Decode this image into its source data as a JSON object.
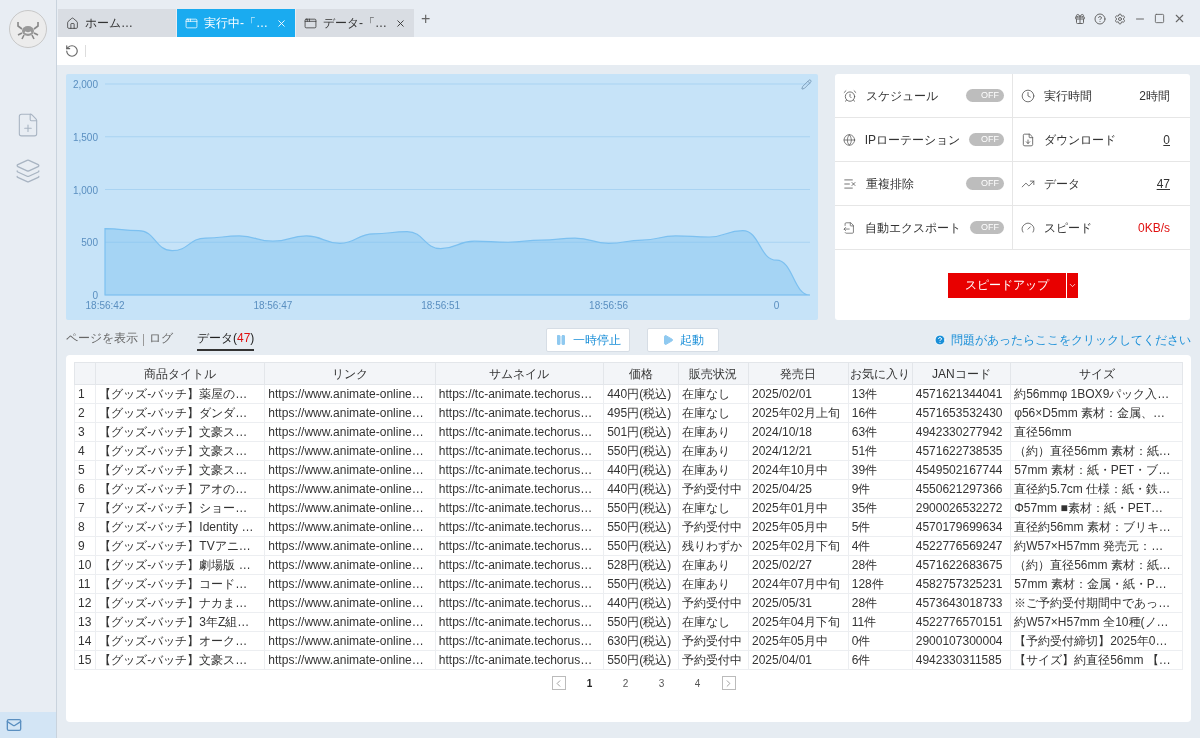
{
  "tabs": [
    {
      "kind": "home",
      "label": "ホーム…",
      "closable": false,
      "selected": false
    },
    {
      "kind": "page",
      "label": "実行中-「…",
      "closable": true,
      "selected": true
    },
    {
      "kind": "page",
      "label": "データ-「…",
      "closable": true,
      "selected": false
    }
  ],
  "new_tab": "+",
  "chart": {
    "chart_data": {
      "type": "area",
      "categories": [
        "18:56:42",
        null,
        null,
        null,
        null,
        "18:56:47",
        null,
        null,
        null,
        null,
        "18:56:51",
        null,
        null,
        null,
        null,
        "18:56:56",
        null,
        null,
        null,
        null,
        "0",
        null
      ],
      "series": [
        {
          "color": "#7cc0f0",
          "values": [
            630,
            610,
            420,
            540,
            560,
            510,
            560,
            490,
            580,
            600,
            440,
            510,
            500,
            520,
            540,
            490,
            520,
            560,
            550,
            610,
            330,
            0
          ]
        }
      ],
      "grid": true,
      "ylim": [
        0,
        2000
      ],
      "yticks": [
        {
          "value": 0,
          "label": "0"
        },
        {
          "value": 500,
          "label": "500"
        },
        {
          "value": 1000,
          "label": "1,000"
        },
        {
          "value": 1500,
          "label": "1,500"
        },
        {
          "value": 2000,
          "label": "2,000"
        }
      ]
    }
  },
  "settings": [
    {
      "kind": "schedule",
      "label": "スケジュール",
      "toggle_label": "OFF",
      "on": false
    },
    {
      "kind": "ip",
      "label": "IPローテーション",
      "toggle_label": "OFF",
      "on": false
    },
    {
      "kind": "dedupe",
      "label": "重複排除",
      "toggle_label": "OFF",
      "on": false
    },
    {
      "kind": "export",
      "label": "自動エクスポート",
      "toggle_label": "OFF",
      "on": false
    }
  ],
  "stats": [
    {
      "kind": "time",
      "label": "実行時間",
      "value": "2時間"
    },
    {
      "kind": "download",
      "label": "ダウンロード",
      "value": "0"
    },
    {
      "kind": "data",
      "label": "データ",
      "value": "47"
    },
    {
      "kind": "speed",
      "label": "スピード",
      "value": "0KB/s"
    }
  ],
  "speed_up_button": "スピードアップ",
  "view_tabs": [
    {
      "label": "ページを表示",
      "selected": false
    },
    {
      "label": "ログ",
      "selected": false
    },
    {
      "label": "データ",
      "count": "47",
      "brackets": [
        "(",
        ")"
      ],
      "selected": true
    }
  ],
  "controls": [
    {
      "kind": "pause",
      "label": "一時停止"
    },
    {
      "kind": "play",
      "label": "起動"
    }
  ],
  "help_link": "問題があったらここをクリックしてください",
  "table": {
    "columns": [
      "",
      "商品タイトル",
      "リンク",
      "サムネイル",
      "価格",
      "販売状況",
      "発売日",
      "お気に入り",
      "JANコード",
      "サイズ"
    ],
    "rows": [
      [
        "1",
        "【グッズ-バッチ】薬屋の…",
        "https://www.animate-online…",
        "https://tc-animate.techorus…",
        "440円(税込)",
        "在庫なし",
        "2025/02/01",
        "13件",
        "4571621344041",
        "約56mmφ 1BOX9パック入…"
      ],
      [
        "2",
        "【グッズ-バッチ】ダンダ…",
        "https://www.animate-online…",
        "https://tc-animate.techorus…",
        "495円(税込)",
        "在庫なし",
        "2025年02月上旬",
        "16件",
        "4571653532430",
        "φ56×D5mm 素材：金属、…"
      ],
      [
        "3",
        "【グッズ-バッチ】文豪ス…",
        "https://www.animate-online…",
        "https://tc-animate.techorus…",
        "501円(税込)",
        "在庫あり",
        "2024/10/18",
        "63件",
        "4942330277942",
        "直径56mm"
      ],
      [
        "4",
        "【グッズ-バッチ】文豪ス…",
        "https://www.animate-online…",
        "https://tc-animate.techorus…",
        "550円(税込)",
        "在庫あり",
        "2024/12/21",
        "51件",
        "4571622738535",
        "（約）直径56mm 素材：紙…"
      ],
      [
        "5",
        "【グッズ-バッチ】文豪ス…",
        "https://www.animate-online…",
        "https://tc-animate.techorus…",
        "440円(税込)",
        "在庫あり",
        "2024年10月中",
        "39件",
        "4549502167744",
        "57mm 素材：紙・PET・ブ…"
      ],
      [
        "6",
        "【グッズ-バッチ】アオの…",
        "https://www.animate-online…",
        "https://tc-animate.techorus…",
        "440円(税込)",
        "予約受付中",
        "2025/04/25",
        "9件",
        "4550621297366",
        "直径約5.7cm 仕様：紙・鉄…"
      ],
      [
        "7",
        "【グッズ-バッチ】ショー…",
        "https://www.animate-online…",
        "https://tc-animate.techorus…",
        "550円(税込)",
        "在庫なし",
        "2025年01月中",
        "35件",
        "2900026532272",
        "Φ57mm ■素材：紙・PET…"
      ],
      [
        "8",
        "【グッズ-バッチ】Identity …",
        "https://www.animate-online…",
        "https://tc-animate.techorus…",
        "550円(税込)",
        "予約受付中",
        "2025年05月中",
        "5件",
        "4570179699634",
        "直径約56mm 素材：ブリキ…"
      ],
      [
        "9",
        "【グッズ-バッチ】TVアニ…",
        "https://www.animate-online…",
        "https://tc-animate.techorus…",
        "550円(税込)",
        "残りわずか",
        "2025年02月下旬",
        "4件",
        "4522776569247",
        "約W57×H57mm 発売元：…"
      ],
      [
        "10",
        "【グッズ-バッチ】劇場版 …",
        "https://www.animate-online…",
        "https://tc-animate.techorus…",
        "528円(税込)",
        "在庫あり",
        "2025/02/27",
        "28件",
        "4571622683675",
        "（約）直径56mm 素材：紙…"
      ],
      [
        "11",
        "【グッズ-バッチ】コード…",
        "https://www.animate-online…",
        "https://tc-animate.techorus…",
        "550円(税込)",
        "在庫あり",
        "2024年07月中旬",
        "128件",
        "4582757325231",
        "57mm 素材：金属・紙・P…"
      ],
      [
        "12",
        "【グッズ-バッチ】ナカま…",
        "https://www.animate-online…",
        "https://tc-animate.techorus…",
        "440円(税込)",
        "予約受付中",
        "2025/05/31",
        "28件",
        "4573643018733",
        "※ご予約受付期間中であっ…"
      ],
      [
        "13",
        "【グッズ-バッチ】3年Z組…",
        "https://www.animate-online…",
        "https://tc-animate.techorus…",
        "550円(税込)",
        "在庫なし",
        "2025年04月下旬",
        "11件",
        "4522776570151",
        "約W57×H57mm 全10種(ノ…"
      ],
      [
        "14",
        "【グッズ-バッチ】オーク…",
        "https://www.animate-online…",
        "https://tc-animate.techorus…",
        "630円(税込)",
        "予約受付中",
        "2025年05月中",
        "0件",
        "2900107300004",
        "【予約受付締切】2025年0…"
      ],
      [
        "15",
        "【グッズ-バッチ】文豪ス…",
        "https://www.animate-online…",
        "https://tc-animate.techorus…",
        "550円(税込)",
        "予約受付中",
        "2025/04/01",
        "6件",
        "4942330311585",
        "【サイズ】約直径56mm 【…"
      ]
    ]
  },
  "pagination": [
    {
      "label": "1",
      "selected": true
    },
    {
      "label": "2",
      "selected": false
    },
    {
      "label": "3",
      "selected": false
    },
    {
      "label": "4",
      "selected": false
    }
  ]
}
